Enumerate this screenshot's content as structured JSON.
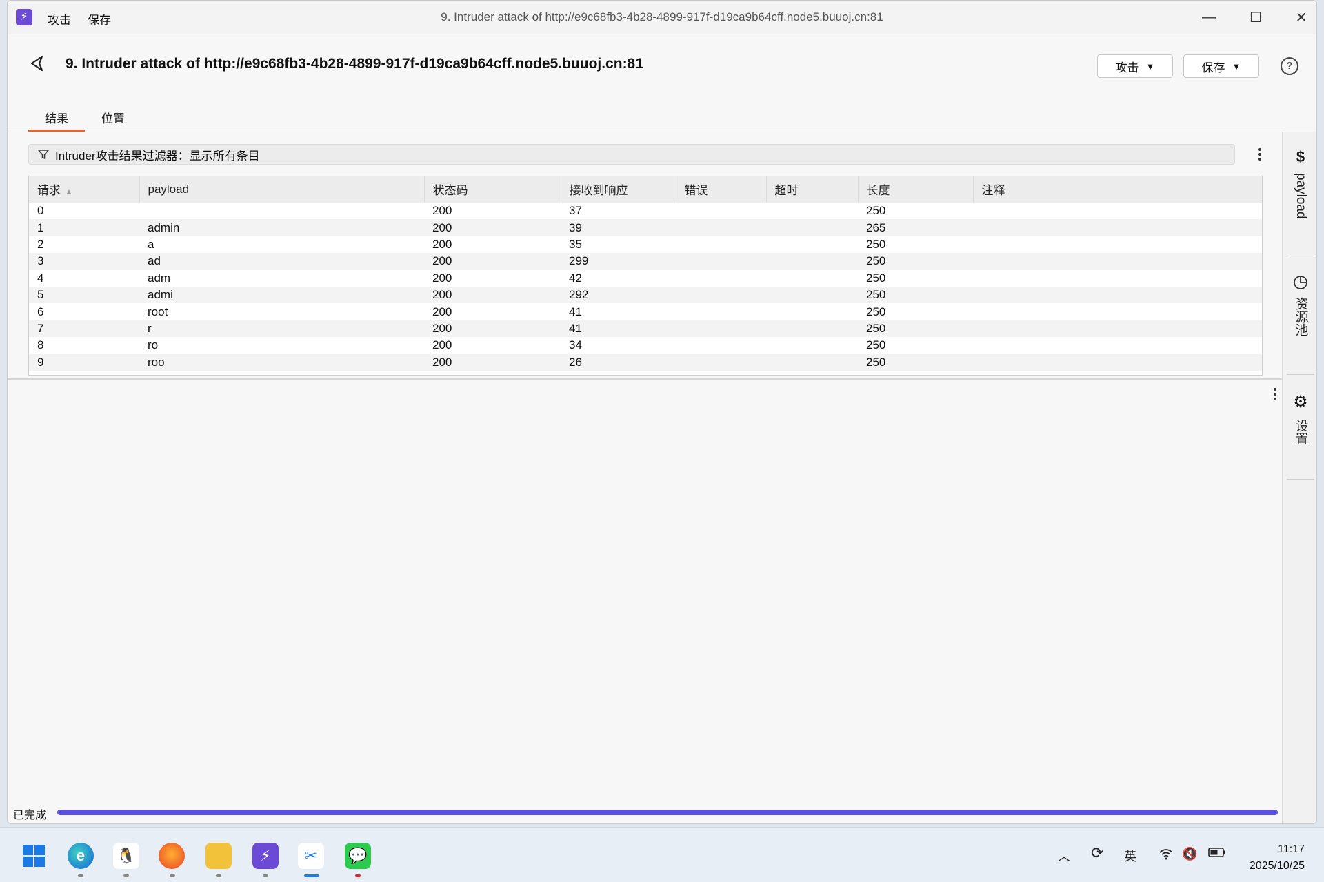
{
  "titlebar": {
    "menu": [
      "攻击",
      "保存"
    ],
    "title": "9. Intruder attack of http://e9c68fb3-4b28-4899-917f-d19ca9b64cff.node5.buuoj.cn:81"
  },
  "header": {
    "title": "9. Intruder attack of http://e9c68fb3-4b28-4899-917f-d19ca9b64cff.node5.buuoj.cn:81",
    "attack_button": "攻击",
    "save_button": "保存",
    "help": "?"
  },
  "tabs": [
    {
      "label": "结果",
      "active": true
    },
    {
      "label": "位置",
      "active": false
    }
  ],
  "filter": {
    "label": "Intruder攻击结果过滤器：显示所有条目"
  },
  "table": {
    "columns": [
      "请求",
      "payload",
      "状态码",
      "接收到响应",
      "错误",
      "超时",
      "长度",
      "注释"
    ],
    "rows": [
      {
        "req": "0",
        "payload": "",
        "status": "200",
        "received": "37",
        "error": "",
        "timeout": "",
        "length": "250",
        "comment": ""
      },
      {
        "req": "1",
        "payload": "admin",
        "status": "200",
        "received": "39",
        "error": "",
        "timeout": "",
        "length": "265",
        "comment": ""
      },
      {
        "req": "2",
        "payload": "a",
        "status": "200",
        "received": "35",
        "error": "",
        "timeout": "",
        "length": "250",
        "comment": ""
      },
      {
        "req": "3",
        "payload": "ad",
        "status": "200",
        "received": "299",
        "error": "",
        "timeout": "",
        "length": "250",
        "comment": ""
      },
      {
        "req": "4",
        "payload": "adm",
        "status": "200",
        "received": "42",
        "error": "",
        "timeout": "",
        "length": "250",
        "comment": ""
      },
      {
        "req": "5",
        "payload": "admi",
        "status": "200",
        "received": "292",
        "error": "",
        "timeout": "",
        "length": "250",
        "comment": ""
      },
      {
        "req": "6",
        "payload": "root",
        "status": "200",
        "received": "41",
        "error": "",
        "timeout": "",
        "length": "250",
        "comment": ""
      },
      {
        "req": "7",
        "payload": "r",
        "status": "200",
        "received": "41",
        "error": "",
        "timeout": "",
        "length": "250",
        "comment": ""
      },
      {
        "req": "8",
        "payload": "ro",
        "status": "200",
        "received": "34",
        "error": "",
        "timeout": "",
        "length": "250",
        "comment": ""
      },
      {
        "req": "9",
        "payload": "roo",
        "status": "200",
        "received": "26",
        "error": "",
        "timeout": "",
        "length": "250",
        "comment": ""
      }
    ]
  },
  "side_panel": {
    "payload": "payload",
    "resource_pool": "资源池",
    "settings": "设置"
  },
  "status": {
    "text": "已完成",
    "progress": 1.0
  },
  "taskbar": {
    "ime": "英",
    "time": "11:17",
    "date": "2025/10/25"
  },
  "colors": {
    "accent": "#e8642b",
    "progress": "#5a4fe0",
    "app_logo": "#6b4bd6"
  }
}
